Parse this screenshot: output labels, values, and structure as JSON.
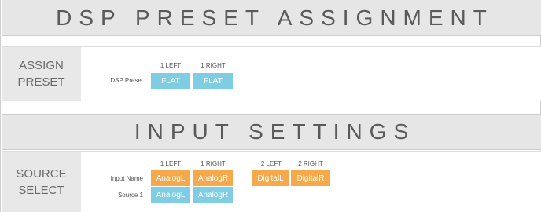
{
  "dsp_section": {
    "title": "DSP PRESET ASSIGNMENT",
    "row_label_line1": "ASSIGN",
    "row_label_line2": "PRESET",
    "columns": [
      "1 LEFT",
      "1 RIGHT"
    ],
    "field_label": "DSP Preset",
    "values": [
      "FLAT",
      "FLAT"
    ],
    "value_color": "#7fcde3"
  },
  "input_section": {
    "title": "INPUT SETTINGS",
    "row_label_line1": "SOURCE",
    "row_label_line2": "SELECT",
    "columns": [
      "1 LEFT",
      "1 RIGHT",
      "2 LEFT",
      "2 RIGHT"
    ],
    "input_name_label": "Input Name",
    "input_names": [
      "AnalogL",
      "AnalogR",
      "DigitalL",
      "DigitalR"
    ],
    "input_name_color": "#f5a94a",
    "source1_label": "Source 1",
    "source1_values": [
      "AnalogL",
      "AnalogR"
    ],
    "source1_color": "#7fcde3"
  }
}
